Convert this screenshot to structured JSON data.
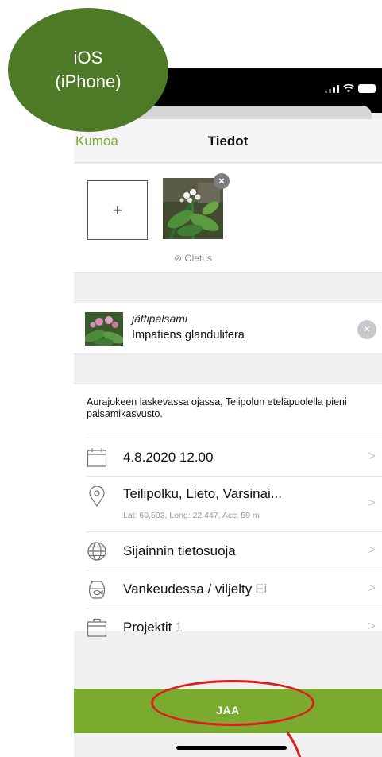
{
  "annotation": {
    "os_line1": "iOS",
    "os_line2": "(iPhone)",
    "bubble_color": "#4e7a28",
    "highlight_color": "#e01d1d"
  },
  "nav": {
    "cancel_label": "Kumoa",
    "title": "Tiedot",
    "accent_color": "#7aaa2e"
  },
  "photos": {
    "add_symbol": "+",
    "remove_symbol": "×",
    "default_label": "⊘ Oletus"
  },
  "species": {
    "common_name": "jättipalsami",
    "scientific_name": "Impatiens glandulifera",
    "clear_symbol": "×"
  },
  "notes": {
    "text": "Aurajokeen laskevassa ojassa, Telipolun eteläpuolella pieni palsamikasvusto."
  },
  "details": [
    {
      "icon": "calendar-icon",
      "label": "4.8.2020 12.00"
    },
    {
      "icon": "location-pin-icon",
      "label": "Teilipolku, Lieto, Varsinai...",
      "sub": "Lat: 60,503, Long: 22,447, Acc: 59 m"
    },
    {
      "icon": "globe-icon",
      "label": "Sijainnin tietosuoja"
    },
    {
      "icon": "fishbowl-icon",
      "label": "Vankeudessa / viljelty",
      "value": "Ei"
    },
    {
      "icon": "briefcase-icon",
      "label": "Projektit",
      "value": "1"
    }
  ],
  "share": {
    "label": "JAA"
  }
}
